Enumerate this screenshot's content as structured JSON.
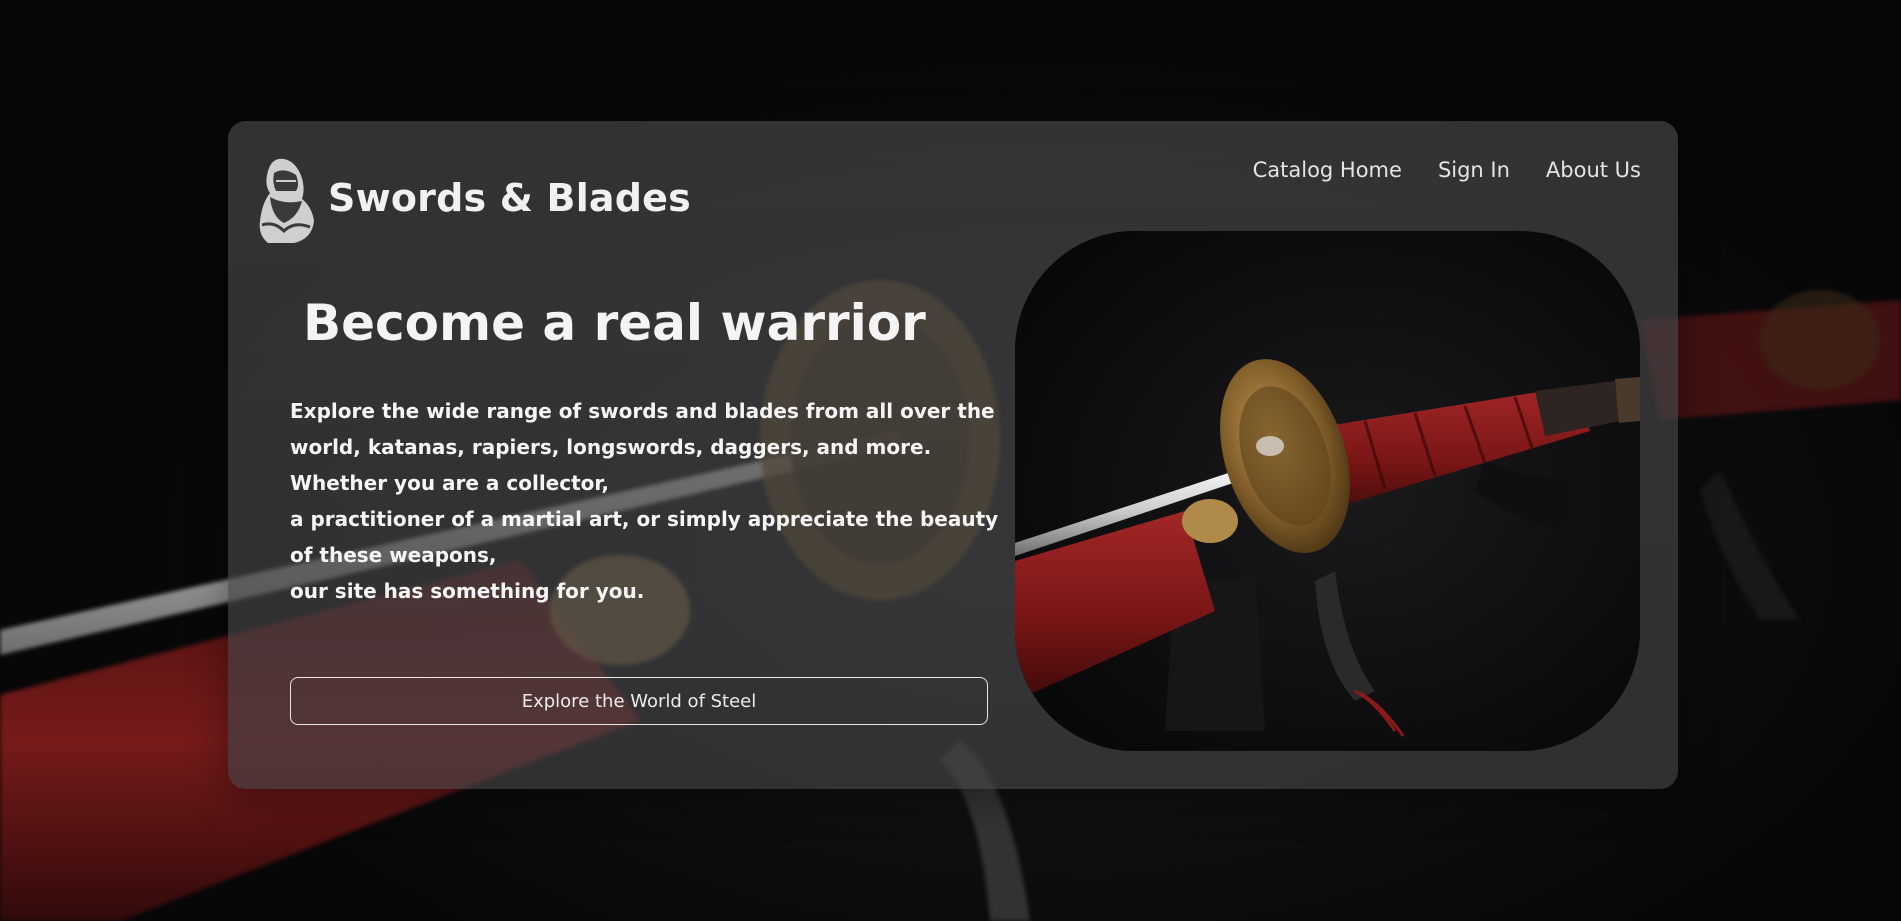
{
  "brand": {
    "name": "Swords & Blades",
    "logo_icon": "knight-helmet-icon"
  },
  "nav": {
    "items": [
      {
        "label": "Catalog Home"
      },
      {
        "label": "Sign In"
      },
      {
        "label": "About Us"
      }
    ]
  },
  "hero": {
    "title": "Become a real warrior",
    "description_lines": [
      "Explore the wide range of swords and blades from all over the world, katanas, rapiers, longswords, daggers, and more. Whether you are a collector,",
      "a practitioner of a martial art, or simply appreciate the beauty of these weapons,",
      "our site has something for you."
    ],
    "cta_label": "Explore the World of Steel",
    "image_icon": "katana-image"
  },
  "colors": {
    "background": "#0b0b0c",
    "card": "#48484a",
    "text": "#f4f4f4",
    "handle_red": "#8f1d1d",
    "guard_gold": "#a57a3e"
  }
}
